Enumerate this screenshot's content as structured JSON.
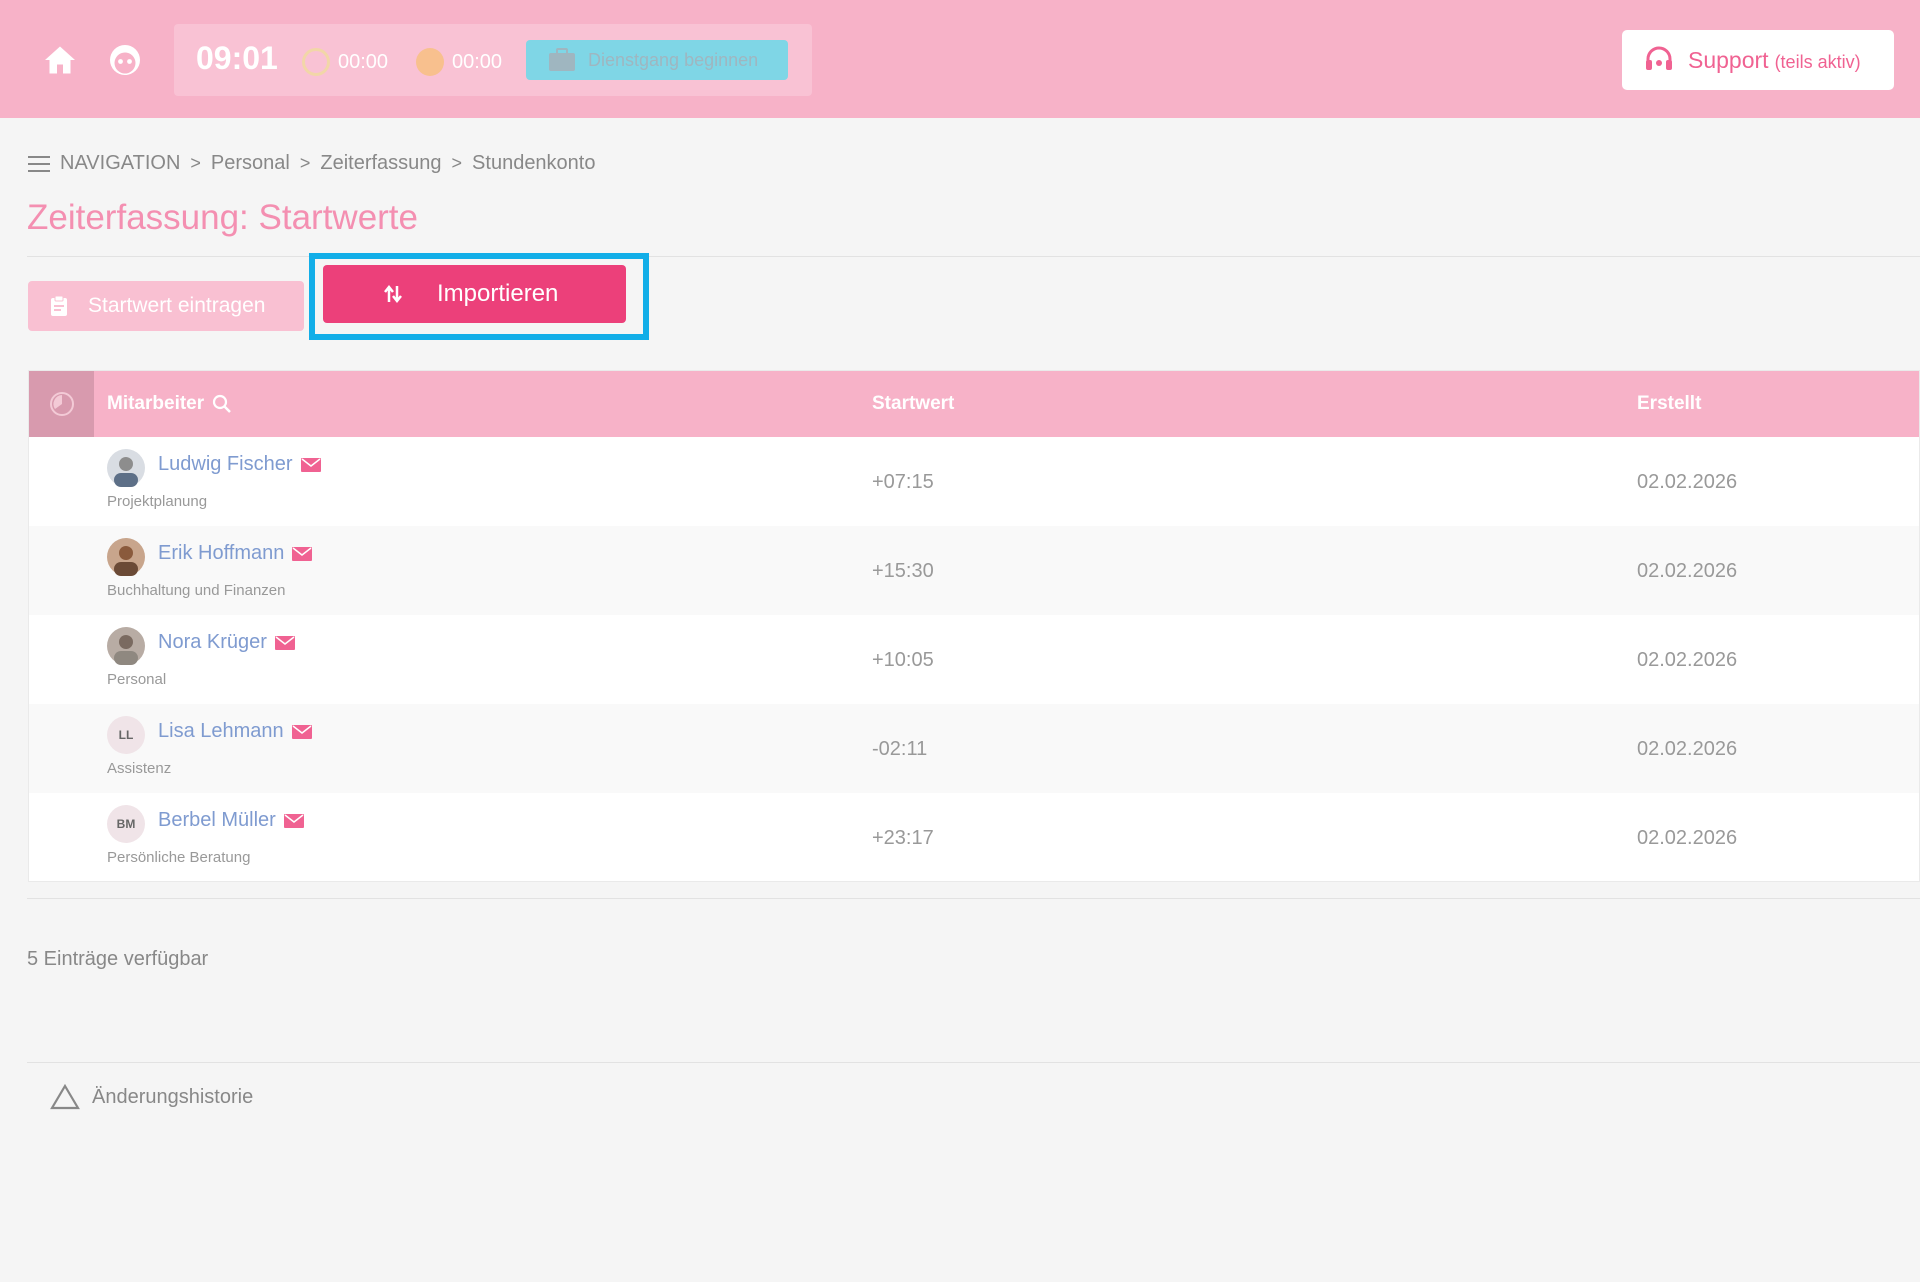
{
  "topbar": {
    "clock": "09:01",
    "timer1": "00:00",
    "timer2": "00:00",
    "duty_button": "Dienstgang beginnen",
    "support_label": "Support",
    "support_sub": "(teils aktiv)",
    "colors": {
      "bar": "#f7b2c8",
      "duty": "#7fd6e6",
      "accent": "#ec407a"
    }
  },
  "breadcrumb": {
    "items": [
      "NAVIGATION",
      "Personal",
      "Zeiterfassung",
      "Stundenkonto"
    ],
    "separator": ">"
  },
  "page": {
    "title": "Zeiterfassung: Startwerte"
  },
  "actions": {
    "start_entry": "Startwert eintragen",
    "import": "Importieren"
  },
  "table": {
    "headers": {
      "employee": "Mitarbeiter",
      "start": "Startwert",
      "created": "Erstellt"
    },
    "rows": [
      {
        "name": "Ludwig Fischer",
        "dept": "Projektplanung",
        "start": "+07:15",
        "created": "02.02.2026",
        "avatar": "photo"
      },
      {
        "name": "Erik Hoffmann",
        "dept": "Buchhaltung und Finanzen",
        "start": "+15:30",
        "created": "02.02.2026",
        "avatar": "photo"
      },
      {
        "name": "Nora Krüger",
        "dept": "Personal",
        "start": "+10:05",
        "created": "02.02.2026",
        "avatar": "photo"
      },
      {
        "name": "Lisa Lehmann",
        "dept": "Assistenz",
        "start": "-02:11",
        "created": "02.02.2026",
        "avatar": "LL"
      },
      {
        "name": "Berbel Müller",
        "dept": "Persönliche Beratung",
        "start": "+23:17",
        "created": "02.02.2026",
        "avatar": "BM"
      }
    ]
  },
  "footer": {
    "count": "5 Einträge verfügbar",
    "history": "Änderungshistorie"
  },
  "icons": [
    "home-icon",
    "face-icon",
    "clock-icon",
    "pause-icon",
    "briefcase-icon",
    "headset-icon",
    "menu-icon",
    "clipboard-icon",
    "swap-icon",
    "pie-icon",
    "search-icon",
    "mail-icon",
    "warning-icon"
  ]
}
